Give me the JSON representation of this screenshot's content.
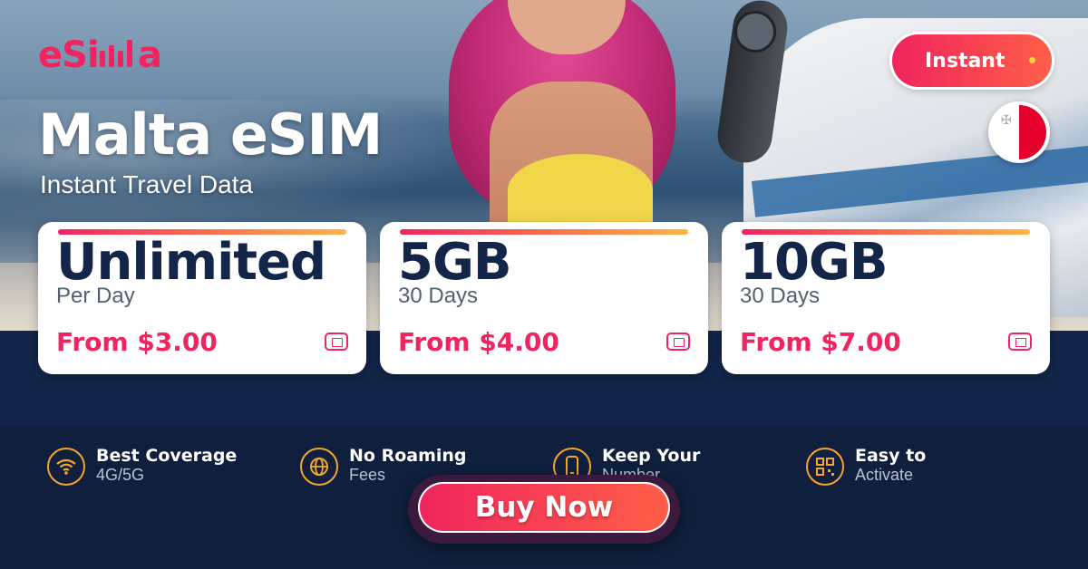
{
  "brand": {
    "logo_text": "eSIMMA",
    "accent": "#f0245e",
    "navy": "#13264a"
  },
  "hero": {
    "title": "Malta eSIM",
    "subtitle": "Instant Travel Data",
    "badge": "Instant",
    "flag_icon": "malta-flag-icon"
  },
  "plans": [
    {
      "amount": "Unlimited",
      "period": "Per Day",
      "price": "From $3.00",
      "icon": "sim-card-icon"
    },
    {
      "amount": "5GB",
      "period": "30 Days",
      "price": "From $4.00",
      "icon": "sim-card-icon"
    },
    {
      "amount": "10GB",
      "period": "30 Days",
      "price": "From $7.00",
      "icon": "sim-card-icon"
    }
  ],
  "features": [
    {
      "title": "Best Coverage",
      "sub": "4G/5G",
      "icon": "wifi-icon"
    },
    {
      "title": "No Roaming",
      "sub": "Fees",
      "icon": "globe-icon"
    },
    {
      "title": "Keep Your",
      "sub": "Number",
      "icon": "phone-icon"
    },
    {
      "title": "Easy to",
      "sub": "Activate",
      "icon": "qr-code-icon"
    }
  ],
  "cta": {
    "label": "Buy Now"
  }
}
